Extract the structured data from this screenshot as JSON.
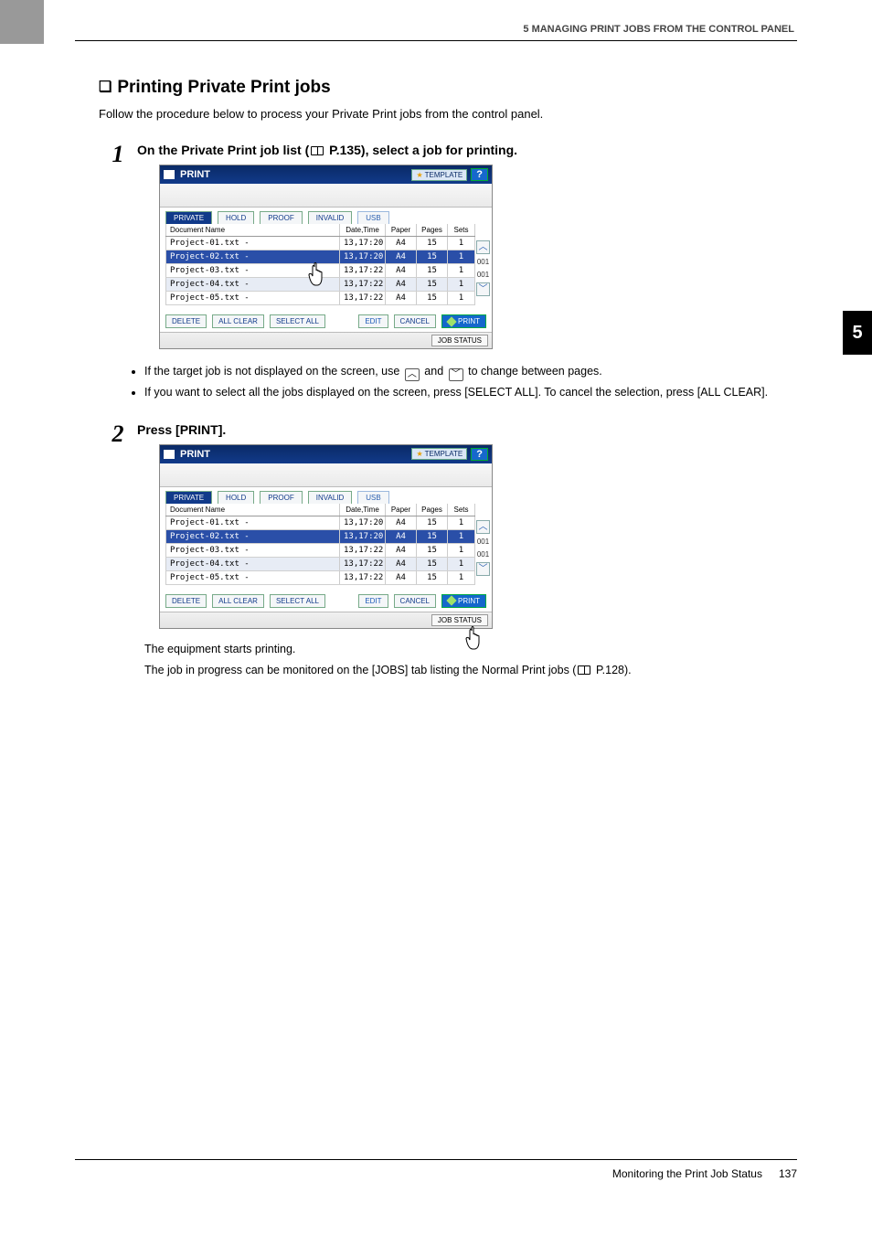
{
  "header": {
    "chapter": "5 MANAGING PRINT JOBS FROM THE CONTROL PANEL"
  },
  "section": {
    "title": "Printing Private Print jobs",
    "intro": "Follow the procedure below to process your Private Print jobs from the control panel."
  },
  "steps": {
    "s1": {
      "num": "1",
      "heading_pre": "On the Private Print job list (",
      "heading_ref": "P.135",
      "heading_post": "), select a job for printing."
    },
    "s2": {
      "num": "2",
      "heading": "Press [PRINT].",
      "after1": "The equipment starts printing.",
      "after2_pre": "The job in progress can be monitored on the [JOBS] tab listing the Normal Print jobs (",
      "after2_ref": "P.128",
      "after2_post": ")."
    }
  },
  "bullets": {
    "b1_pre": "If the target job is not displayed on the screen, use ",
    "b1_mid": " and ",
    "b1_post": " to change between pages.",
    "b2": "If you want to select all the jobs displayed on the screen, press [SELECT ALL]. To cancel the selection, press [ALL CLEAR]."
  },
  "panel": {
    "title": "PRINT",
    "template": "TEMPLATE",
    "help": "?",
    "tabs": {
      "private": "PRIVATE",
      "hold": "HOLD",
      "proof": "PROOF",
      "invalid": "INVALID",
      "usb": "USB"
    },
    "columns": {
      "doc": "Document Name",
      "dt": "Date,Time",
      "paper": "Paper",
      "pages": "Pages",
      "sets": "Sets"
    },
    "rows": [
      {
        "doc": "Project-01.txt -",
        "dt": "13,17:20",
        "paper": "A4",
        "pages": "15",
        "sets": "1"
      },
      {
        "doc": "Project-02.txt -",
        "dt": "13,17:20",
        "paper": "A4",
        "pages": "15",
        "sets": "1"
      },
      {
        "doc": "Project-03.txt -",
        "dt": "13,17:22",
        "paper": "A4",
        "pages": "15",
        "sets": "1"
      },
      {
        "doc": "Project-04.txt -",
        "dt": "13,17:22",
        "paper": "A4",
        "pages": "15",
        "sets": "1"
      },
      {
        "doc": "Project-05.txt -",
        "dt": "13,17:22",
        "paper": "A4",
        "pages": "15",
        "sets": "1"
      }
    ],
    "scroll": {
      "page_top": "001",
      "page_bot": "001"
    },
    "actions": {
      "delete": "DELETE",
      "allclear": "ALL CLEAR",
      "selectall": "SELECT ALL",
      "edit": "EDIT",
      "cancel": "CANCEL",
      "print": "PRINT"
    },
    "status": "JOB STATUS"
  },
  "side_tab": "5",
  "footer": {
    "title": "Monitoring the Print Job Status",
    "page": "137"
  }
}
